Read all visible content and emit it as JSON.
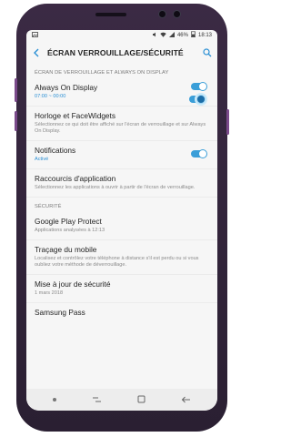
{
  "status": {
    "left_icon": "image-icon",
    "battery": "46%",
    "time": "18:13"
  },
  "header": {
    "title": "ÉCRAN VERROUILLAGE/SÉCURITÉ"
  },
  "sections": {
    "lockscreen": "ÉCRAN DE VERROUILLAGE ET ALWAYS ON DISPLAY",
    "security": "SÉCURITÉ"
  },
  "items": {
    "aod": {
      "title": "Always On Display",
      "subtitle": "07:00 ~ 00:00"
    },
    "clock": {
      "title": "Horloge et FaceWidgets",
      "subtitle": "Sélectionnez ce qui doit être affiché sur l'écran de verrouillage et sur Always On Display."
    },
    "notifications": {
      "title": "Notifications",
      "subtitle": "Activé"
    },
    "shortcuts": {
      "title": "Raccourcis d'application",
      "subtitle": "Sélectionnez les applications à ouvrir à partir de l'écran de verrouillage."
    },
    "gpp": {
      "title": "Google Play Protect",
      "subtitle": "Applications analysées à 12:13"
    },
    "find": {
      "title": "Traçage du mobile",
      "subtitle": "Localisez et contrôlez votre téléphone à distance s'il est perdu ou si vous oubliez votre méthode de déverrouillage."
    },
    "update": {
      "title": "Mise à jour de sécurité",
      "subtitle": "1 mars 2018"
    },
    "pass": {
      "title": "Samsung Pass"
    }
  },
  "colors": {
    "accent": "#3a9ed8",
    "frame": "#3b2a44"
  }
}
